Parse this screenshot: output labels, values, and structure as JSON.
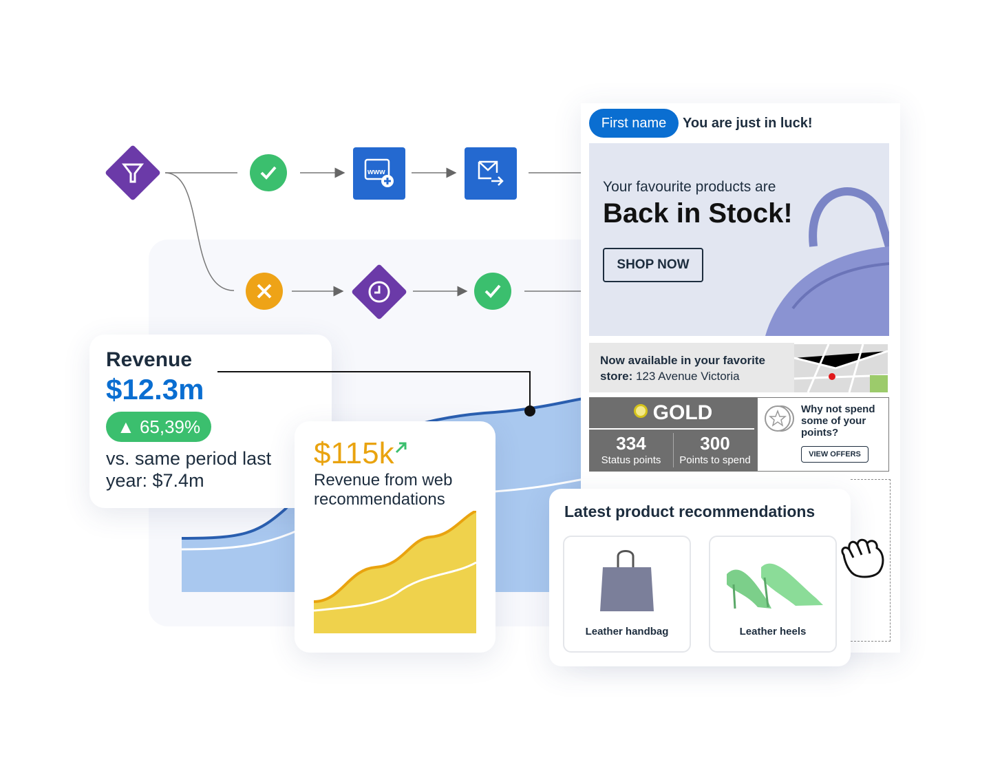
{
  "flow": {
    "nodes": [
      "filter-icon",
      "check-icon",
      "web-add-icon",
      "email-forward-icon",
      "cancel-icon",
      "clock-icon",
      "check-icon"
    ],
    "colors": {
      "purple": "#6b3aa8",
      "green": "#3bbf6e",
      "orange": "#eea317",
      "blue": "#2469d0"
    }
  },
  "revenue": {
    "title": "Revenue",
    "value": "$12.3m",
    "change": "▲ 65,39%",
    "comparison": "vs. same period last year: $7.4m"
  },
  "web": {
    "value": "$115k",
    "trend_icon": "arrow-up-right-icon",
    "label": "Revenue from web recommendations"
  },
  "email": {
    "personalization_pill": "First name",
    "greeting": "You are just in luck!",
    "hero_intro": "Your favourite products are",
    "hero_title": "Back in Stock!",
    "shop_button": "SHOP NOW",
    "store_bold": "Now available in your favorite store:",
    "store_address": "123 Avenue Victoria",
    "tier": "GOLD",
    "status_points": "334",
    "status_points_label": "Status points",
    "spend_points": "300",
    "spend_points_label": "Points to spend",
    "offer_text": "Why not spend some of your points?",
    "offer_button": "VIEW OFFERS"
  },
  "recommendations": {
    "title": "Latest product recommendations",
    "items": [
      {
        "name": "Leather handbag"
      },
      {
        "name": "Leather heels"
      }
    ]
  },
  "colors": {
    "accent_blue": "#0a6ed1",
    "revenue_blue": "#0a6ed1",
    "gold_text": "#e9a30f",
    "badge_green": "#3bbf6e"
  }
}
